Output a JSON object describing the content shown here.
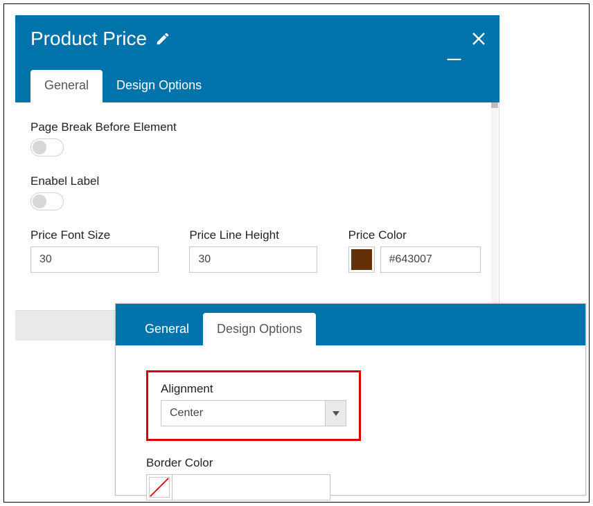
{
  "dialog1": {
    "title": "Product Price",
    "tabs": {
      "general": "General",
      "design": "Design Options"
    },
    "pageBreak": {
      "label": "Page Break Before Element",
      "value": false
    },
    "enableLabel": {
      "label": "Enabel Label",
      "value": false
    },
    "priceFontSize": {
      "label": "Price Font Size",
      "value": "30"
    },
    "priceLineHeight": {
      "label": "Price Line Height",
      "value": "30"
    },
    "priceColor": {
      "label": "Price Color",
      "hex": "#643007"
    }
  },
  "dialog2": {
    "tabs": {
      "general": "General",
      "design": "Design Options"
    },
    "alignment": {
      "label": "Alignment",
      "value": "Center"
    },
    "borderColor": {
      "label": "Border Color",
      "value": ""
    }
  }
}
